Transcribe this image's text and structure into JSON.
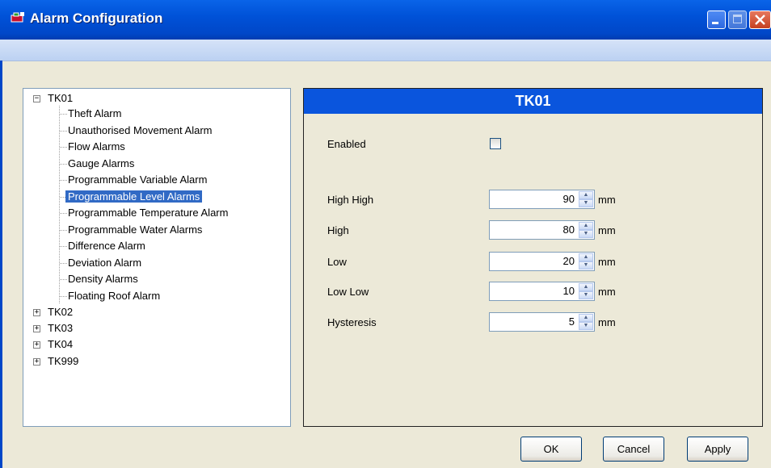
{
  "window": {
    "title": "Alarm Configuration"
  },
  "tree": {
    "tk01": {
      "label": "TK01",
      "children": [
        "Theft Alarm",
        "Unauthorised Movement Alarm",
        "Flow Alarms",
        "Gauge Alarms",
        "Programmable Variable Alarm",
        "Programmable Level Alarms",
        "Programmable Temperature Alarm",
        "Programmable Water Alarms",
        "Difference Alarm",
        "Deviation Alarm",
        "Density Alarms",
        "Floating Roof Alarm"
      ],
      "selected": "Programmable Level Alarms"
    },
    "others": [
      "TK02",
      "TK03",
      "TK04",
      "TK999"
    ]
  },
  "detail": {
    "header": "TK01",
    "enabled_label": "Enabled",
    "enabled_checked": false,
    "fields": [
      {
        "label": "High High",
        "value": "90",
        "unit": "mm"
      },
      {
        "label": "High",
        "value": "80",
        "unit": "mm"
      },
      {
        "label": "Low",
        "value": "20",
        "unit": "mm"
      },
      {
        "label": "Low Low",
        "value": "10",
        "unit": "mm"
      },
      {
        "label": "Hysteresis",
        "value": "5",
        "unit": "mm"
      }
    ]
  },
  "buttons": {
    "ok": "OK",
    "cancel": "Cancel",
    "apply": "Apply"
  },
  "colors": {
    "titlebar": "#0054E3",
    "selection": "#316AC5",
    "panel_header": "#0A55DD"
  }
}
